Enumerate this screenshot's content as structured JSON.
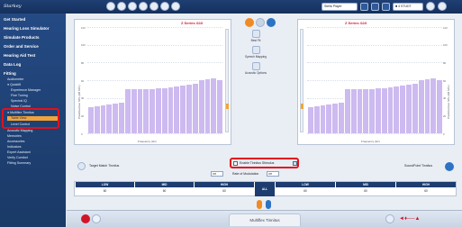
{
  "app": {
    "logo_text": "Starkey"
  },
  "topbar": {
    "icons": [
      "home-icon",
      "person-icon",
      "document-icon",
      "headset-icon",
      "chart-icon",
      "gear-icon",
      "globe-icon"
    ],
    "session_select": "Stella Player",
    "device_select": "■ 4 STUDT",
    "accent": "#f2a23a"
  },
  "sidebar": {
    "items": [
      {
        "label": "Get Started"
      },
      {
        "label": "Hearing Loss Simulator"
      },
      {
        "label": "Simulate Products"
      },
      {
        "label": "Order and Service"
      },
      {
        "label": "Hearing Aid Test"
      },
      {
        "label": "Data Log"
      },
      {
        "label": "Fitting"
      }
    ],
    "fitting_sub": [
      {
        "label": "Audiometer"
      },
      {
        "label": "● Quickfit"
      },
      {
        "label": "Experience Manager"
      },
      {
        "label": "Fine Tuning"
      },
      {
        "label": "Spectral iQ"
      },
      {
        "label": "Noise Control"
      },
      {
        "label": "● Multiflex Tinnitus"
      },
      {
        "label": "Table View"
      },
      {
        "label": "Level Control"
      },
      {
        "label": "Acoustic Mapping"
      },
      {
        "label": "Memories"
      },
      {
        "label": "Accessories"
      },
      {
        "label": "Indicators"
      },
      {
        "label": "Expert Assistant"
      },
      {
        "label": "Verify Comfort"
      },
      {
        "label": "Fitting Summary"
      }
    ]
  },
  "left_chart": {
    "title": "Z Series i110",
    "ylabel": "Predicted Ear SPL (dB SPL)",
    "xlabel": "Frequency (Hz)"
  },
  "right_chart": {
    "title": "Z Series i110",
    "ylabel": "Predicted Ear SPL (dB SPL)",
    "xlabel": "Frequency (Hz)"
  },
  "center_panel": {
    "first_fit_label": "Best Fit",
    "speech_mapping_label": "Speech Mapping",
    "acoustic_options_label": "Acoustic Options"
  },
  "controls": {
    "target_match_label": "Target Match Tinnitus",
    "enable_tinnitus_label": "Enable Tinnitus Stimulus",
    "lock_label": "Off",
    "rate_label": "Rate of Modulation",
    "rate_value": "Off",
    "soundpoint_label": "SoundPoint Tinnitus"
  },
  "table": {
    "left_headers": [
      "LOW",
      "MID",
      "HIGH"
    ],
    "left_values": [
      "60",
      "60",
      "60"
    ],
    "all_label": "ALL",
    "right_headers": [
      "LOW",
      "MID",
      "HIGH"
    ],
    "right_values": [
      "60",
      "60",
      "60"
    ]
  },
  "footer": {
    "tab_title": "Multiflex Tinnitus"
  },
  "chart_data": [
    {
      "type": "bar",
      "title": "Z Series i110",
      "xlabel": "Frequency (Hz)",
      "ylabel": "Predicted Ear SPL (dB SPL)",
      "ylim": [
        0,
        120
      ],
      "values": [
        30,
        31,
        32,
        33,
        34,
        35,
        50,
        50,
        50,
        50,
        50,
        51,
        51,
        52,
        53,
        54,
        55,
        56,
        60,
        61,
        62,
        60
      ]
    },
    {
      "type": "bar",
      "title": "Z Series i110",
      "xlabel": "Frequency (Hz)",
      "ylabel": "Predicted Ear SPL (dB SPL)",
      "ylim": [
        0,
        120
      ],
      "values": [
        30,
        31,
        32,
        33,
        34,
        35,
        50,
        50,
        50,
        50,
        50,
        51,
        51,
        52,
        53,
        54,
        55,
        56,
        60,
        61,
        62,
        60
      ]
    }
  ]
}
